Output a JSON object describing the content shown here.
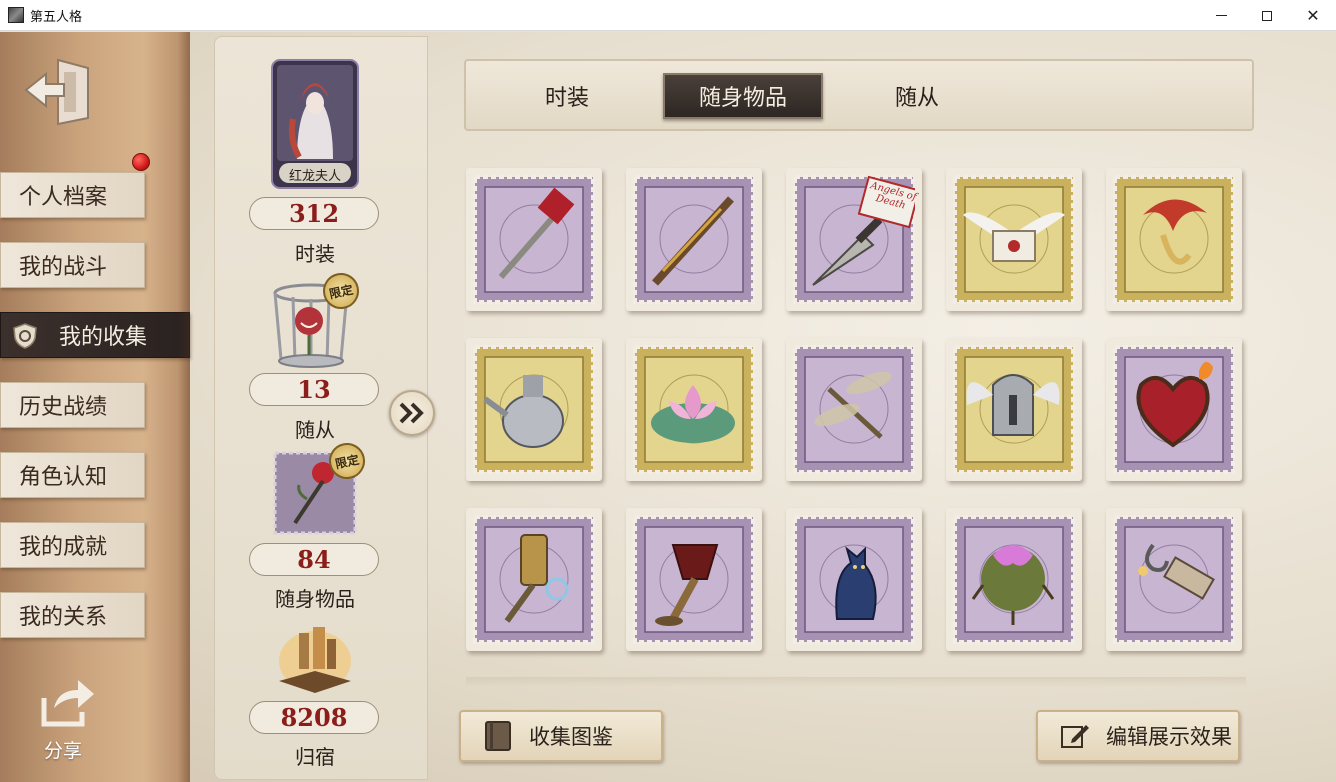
{
  "window": {
    "title": "第五人格"
  },
  "sidebar": {
    "items": [
      {
        "label": "个人档案",
        "name": "sidebar-item-profile"
      },
      {
        "label": "我的战斗",
        "name": "sidebar-item-battles"
      },
      {
        "label": "我的收集",
        "name": "sidebar-item-collection",
        "active": true
      },
      {
        "label": "历史战绩",
        "name": "sidebar-item-history"
      },
      {
        "label": "角色认知",
        "name": "sidebar-item-character"
      },
      {
        "label": "我的成就",
        "name": "sidebar-item-achievements"
      },
      {
        "label": "我的关系",
        "name": "sidebar-item-relations"
      }
    ],
    "share_label": "分享"
  },
  "stats": {
    "portrait_name": "红龙夫人",
    "limited_badge": "限定",
    "items": [
      {
        "value": "312",
        "label": "时装"
      },
      {
        "value": "13",
        "label": "随从"
      },
      {
        "value": "84",
        "label": "随身物品"
      },
      {
        "value": "8208",
        "label": "归宿"
      }
    ]
  },
  "tabs": [
    {
      "label": "时装",
      "active": false
    },
    {
      "label": "随身物品",
      "active": true
    },
    {
      "label": "随从",
      "active": false
    }
  ],
  "grid": {
    "items": [
      {
        "icon": "red-hammer-icon",
        "frame": "purple"
      },
      {
        "icon": "ornate-staff-icon",
        "frame": "purple"
      },
      {
        "icon": "angels-of-death-knife-icon",
        "frame": "purple",
        "sign_text": "Angels of Death"
      },
      {
        "icon": "winged-letter-icon",
        "frame": "gold"
      },
      {
        "icon": "phoenix-ornament-icon",
        "frame": "gold"
      },
      {
        "icon": "silver-teapot-icon",
        "frame": "gold"
      },
      {
        "icon": "lotus-flower-icon",
        "frame": "gold"
      },
      {
        "icon": "dragonfly-icon",
        "frame": "purple"
      },
      {
        "icon": "winged-helmet-icon",
        "frame": "gold"
      },
      {
        "icon": "flaming-heart-icon",
        "frame": "purple"
      },
      {
        "icon": "lantern-key-icon",
        "frame": "purple"
      },
      {
        "icon": "blood-goblet-icon",
        "frame": "purple"
      },
      {
        "icon": "blue-cat-figure-icon",
        "frame": "purple"
      },
      {
        "icon": "thorny-flower-icon",
        "frame": "purple"
      },
      {
        "icon": "dynamite-hook-icon",
        "frame": "purple"
      }
    ]
  },
  "buttons": {
    "collection_guide": "收集图鉴",
    "edit_display": "编辑展示效果"
  }
}
